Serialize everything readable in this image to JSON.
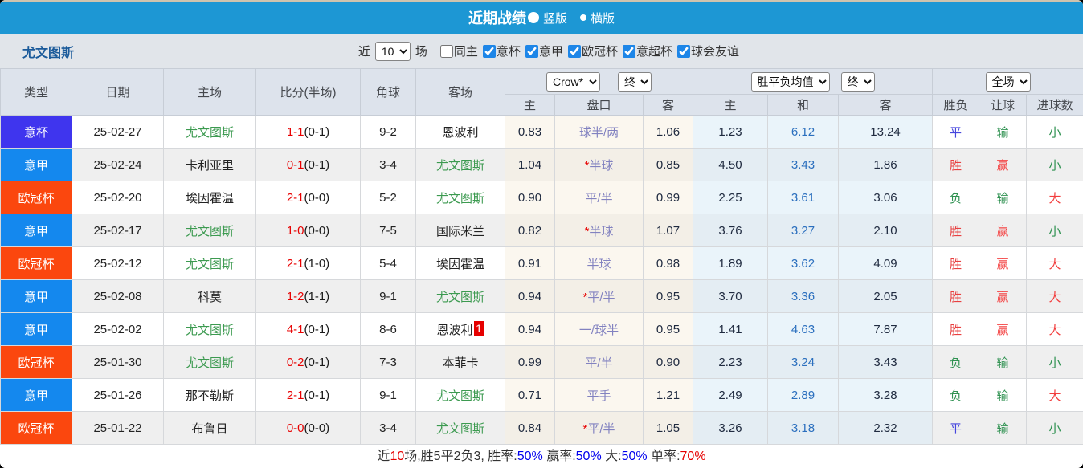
{
  "title_bar": {
    "title": "近期战绩",
    "radio_vertical": "竖版",
    "radio_horizontal": "横版"
  },
  "filter_bar": {
    "team_name": "尤文图斯",
    "recent_label": "近",
    "count_select": "10",
    "matches_label": "场",
    "checkboxes": [
      {
        "key": "same-home",
        "label": "同主",
        "checked": false
      },
      {
        "key": "coppa-italia",
        "label": "意杯",
        "checked": true
      },
      {
        "key": "serie-a",
        "label": "意甲",
        "checked": true
      },
      {
        "key": "champions-league",
        "label": "欧冠杯",
        "checked": true
      },
      {
        "key": "super-cup",
        "label": "意超杯",
        "checked": true
      },
      {
        "key": "club-friendly",
        "label": "球会友谊",
        "checked": true
      }
    ]
  },
  "table": {
    "headers": {
      "type": "类型",
      "date": "日期",
      "home": "主场",
      "score": "比分(半场)",
      "corner": "角球",
      "away": "客场",
      "odds_select": "Crow*",
      "odds_time_select": "终",
      "odds_sub_home": "主",
      "odds_sub_handicap": "盘口",
      "odds_sub_away": "客",
      "avg_select": "胜平负均值",
      "avg_time_select": "终",
      "avg_sub_home": "主",
      "avg_sub_draw": "和",
      "avg_sub_away": "客",
      "fulltime_select": "全场",
      "result_sub_wdl": "胜负",
      "result_sub_handicap": "让球",
      "result_sub_goals": "进球数"
    },
    "rows": [
      {
        "type": "意杯",
        "date": "25-02-27",
        "home": "尤文图斯",
        "home_team": true,
        "score": "1-1",
        "half": "(0-1)",
        "corner": "9-2",
        "away": "恩波利",
        "away_team": false,
        "away_badge": "",
        "o1": "0.83",
        "star": false,
        "hc": "球半/两",
        "o2": "1.06",
        "a1": "1.23",
        "a2": "6.12",
        "a3": "13.24",
        "r1": "平",
        "r2": "输",
        "r3": "小"
      },
      {
        "type": "意甲",
        "date": "25-02-24",
        "home": "卡利亚里",
        "home_team": false,
        "score": "0-1",
        "half": "(0-1)",
        "corner": "3-4",
        "away": "尤文图斯",
        "away_team": true,
        "away_badge": "",
        "o1": "1.04",
        "star": true,
        "hc": "半球",
        "o2": "0.85",
        "a1": "4.50",
        "a2": "3.43",
        "a3": "1.86",
        "r1": "胜",
        "r2": "赢",
        "r3": "小"
      },
      {
        "type": "欧冠杯",
        "date": "25-02-20",
        "home": "埃因霍温",
        "home_team": false,
        "score": "2-1",
        "half": "(0-0)",
        "corner": "5-2",
        "away": "尤文图斯",
        "away_team": true,
        "away_badge": "",
        "o1": "0.90",
        "star": false,
        "hc": "平/半",
        "o2": "0.99",
        "a1": "2.25",
        "a2": "3.61",
        "a3": "3.06",
        "r1": "负",
        "r2": "输",
        "r3": "大"
      },
      {
        "type": "意甲",
        "date": "25-02-17",
        "home": "尤文图斯",
        "home_team": true,
        "score": "1-0",
        "half": "(0-0)",
        "corner": "7-5",
        "away": "国际米兰",
        "away_team": false,
        "away_badge": "",
        "o1": "0.82",
        "star": true,
        "hc": "半球",
        "o2": "1.07",
        "a1": "3.76",
        "a2": "3.27",
        "a3": "2.10",
        "r1": "胜",
        "r2": "赢",
        "r3": "小"
      },
      {
        "type": "欧冠杯",
        "date": "25-02-12",
        "home": "尤文图斯",
        "home_team": true,
        "score": "2-1",
        "half": "(1-0)",
        "corner": "5-4",
        "away": "埃因霍温",
        "away_team": false,
        "away_badge": "",
        "o1": "0.91",
        "star": false,
        "hc": "半球",
        "o2": "0.98",
        "a1": "1.89",
        "a2": "3.62",
        "a3": "4.09",
        "r1": "胜",
        "r2": "赢",
        "r3": "大"
      },
      {
        "type": "意甲",
        "date": "25-02-08",
        "home": "科莫",
        "home_team": false,
        "score": "1-2",
        "half": "(1-1)",
        "corner": "9-1",
        "away": "尤文图斯",
        "away_team": true,
        "away_badge": "",
        "o1": "0.94",
        "star": true,
        "hc": "平/半",
        "o2": "0.95",
        "a1": "3.70",
        "a2": "3.36",
        "a3": "2.05",
        "r1": "胜",
        "r2": "赢",
        "r3": "大"
      },
      {
        "type": "意甲",
        "date": "25-02-02",
        "home": "尤文图斯",
        "home_team": true,
        "score": "4-1",
        "half": "(0-1)",
        "corner": "8-6",
        "away": "恩波利",
        "away_team": false,
        "away_badge": "1",
        "o1": "0.94",
        "star": false,
        "hc": "一/球半",
        "o2": "0.95",
        "a1": "1.41",
        "a2": "4.63",
        "a3": "7.87",
        "r1": "胜",
        "r2": "赢",
        "r3": "大"
      },
      {
        "type": "欧冠杯",
        "date": "25-01-30",
        "home": "尤文图斯",
        "home_team": true,
        "score": "0-2",
        "half": "(0-1)",
        "corner": "7-3",
        "away": "本菲卡",
        "away_team": false,
        "away_badge": "",
        "o1": "0.99",
        "star": false,
        "hc": "平/半",
        "o2": "0.90",
        "a1": "2.23",
        "a2": "3.24",
        "a3": "3.43",
        "r1": "负",
        "r2": "输",
        "r3": "小"
      },
      {
        "type": "意甲",
        "date": "25-01-26",
        "home": "那不勒斯",
        "home_team": false,
        "score": "2-1",
        "half": "(0-1)",
        "corner": "9-1",
        "away": "尤文图斯",
        "away_team": true,
        "away_badge": "",
        "o1": "0.71",
        "star": false,
        "hc": "平手",
        "o2": "1.21",
        "a1": "2.49",
        "a2": "2.89",
        "a3": "3.28",
        "r1": "负",
        "r2": "输",
        "r3": "大"
      },
      {
        "type": "欧冠杯",
        "date": "25-01-22",
        "home": "布鲁日",
        "home_team": false,
        "score": "0-0",
        "half": "(0-0)",
        "corner": "3-4",
        "away": "尤文图斯",
        "away_team": true,
        "away_badge": "",
        "o1": "0.84",
        "star": true,
        "hc": "平/半",
        "o2": "1.05",
        "a1": "3.26",
        "a2": "3.18",
        "a3": "2.32",
        "r1": "平",
        "r2": "输",
        "r3": "小"
      }
    ]
  },
  "footer": {
    "segments": [
      {
        "text": "近",
        "color": "#333333"
      },
      {
        "text": "10",
        "color": "#e60000"
      },
      {
        "text": "场,胜5平2负3, 胜率:",
        "color": "#333333"
      },
      {
        "text": "50%",
        "color": "#0000ee"
      },
      {
        "text": " 赢率:",
        "color": "#333333"
      },
      {
        "text": "50%",
        "color": "#0000ee"
      },
      {
        "text": " 大:",
        "color": "#333333"
      },
      {
        "text": "50%",
        "color": "#0000ee"
      },
      {
        "text": " 单率:",
        "color": "#333333"
      },
      {
        "text": "70%",
        "color": "#e60000"
      }
    ]
  },
  "colors": {
    "type_badges": {
      "意杯": "#3f35ee",
      "意甲": "#1488ee",
      "欧冠杯": "#fb470e"
    },
    "results": {
      "胜": "#e84040",
      "平": "#4646dd",
      "负": "#2e9150",
      "赢": "#f44545",
      "输": "#2e9150",
      "大": "#f23d3d",
      "小": "#2e9150"
    },
    "team_green": "#3c9a50"
  }
}
